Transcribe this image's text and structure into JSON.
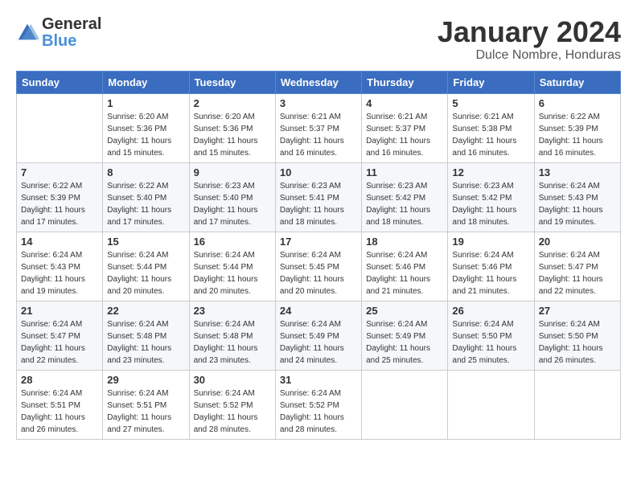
{
  "logo": {
    "text_general": "General",
    "text_blue": "Blue"
  },
  "title": "January 2024",
  "subtitle": "Dulce Nombre, Honduras",
  "weekdays": [
    "Sunday",
    "Monday",
    "Tuesday",
    "Wednesday",
    "Thursday",
    "Friday",
    "Saturday"
  ],
  "weeks": [
    [
      {
        "day": "",
        "sunrise": "",
        "sunset": "",
        "daylight": ""
      },
      {
        "day": "1",
        "sunrise": "Sunrise: 6:20 AM",
        "sunset": "Sunset: 5:36 PM",
        "daylight": "Daylight: 11 hours and 15 minutes."
      },
      {
        "day": "2",
        "sunrise": "Sunrise: 6:20 AM",
        "sunset": "Sunset: 5:36 PM",
        "daylight": "Daylight: 11 hours and 15 minutes."
      },
      {
        "day": "3",
        "sunrise": "Sunrise: 6:21 AM",
        "sunset": "Sunset: 5:37 PM",
        "daylight": "Daylight: 11 hours and 16 minutes."
      },
      {
        "day": "4",
        "sunrise": "Sunrise: 6:21 AM",
        "sunset": "Sunset: 5:37 PM",
        "daylight": "Daylight: 11 hours and 16 minutes."
      },
      {
        "day": "5",
        "sunrise": "Sunrise: 6:21 AM",
        "sunset": "Sunset: 5:38 PM",
        "daylight": "Daylight: 11 hours and 16 minutes."
      },
      {
        "day": "6",
        "sunrise": "Sunrise: 6:22 AM",
        "sunset": "Sunset: 5:39 PM",
        "daylight": "Daylight: 11 hours and 16 minutes."
      }
    ],
    [
      {
        "day": "7",
        "sunrise": "Sunrise: 6:22 AM",
        "sunset": "Sunset: 5:39 PM",
        "daylight": "Daylight: 11 hours and 17 minutes."
      },
      {
        "day": "8",
        "sunrise": "Sunrise: 6:22 AM",
        "sunset": "Sunset: 5:40 PM",
        "daylight": "Daylight: 11 hours and 17 minutes."
      },
      {
        "day": "9",
        "sunrise": "Sunrise: 6:23 AM",
        "sunset": "Sunset: 5:40 PM",
        "daylight": "Daylight: 11 hours and 17 minutes."
      },
      {
        "day": "10",
        "sunrise": "Sunrise: 6:23 AM",
        "sunset": "Sunset: 5:41 PM",
        "daylight": "Daylight: 11 hours and 18 minutes."
      },
      {
        "day": "11",
        "sunrise": "Sunrise: 6:23 AM",
        "sunset": "Sunset: 5:42 PM",
        "daylight": "Daylight: 11 hours and 18 minutes."
      },
      {
        "day": "12",
        "sunrise": "Sunrise: 6:23 AM",
        "sunset": "Sunset: 5:42 PM",
        "daylight": "Daylight: 11 hours and 18 minutes."
      },
      {
        "day": "13",
        "sunrise": "Sunrise: 6:24 AM",
        "sunset": "Sunset: 5:43 PM",
        "daylight": "Daylight: 11 hours and 19 minutes."
      }
    ],
    [
      {
        "day": "14",
        "sunrise": "Sunrise: 6:24 AM",
        "sunset": "Sunset: 5:43 PM",
        "daylight": "Daylight: 11 hours and 19 minutes."
      },
      {
        "day": "15",
        "sunrise": "Sunrise: 6:24 AM",
        "sunset": "Sunset: 5:44 PM",
        "daylight": "Daylight: 11 hours and 20 minutes."
      },
      {
        "day": "16",
        "sunrise": "Sunrise: 6:24 AM",
        "sunset": "Sunset: 5:44 PM",
        "daylight": "Daylight: 11 hours and 20 minutes."
      },
      {
        "day": "17",
        "sunrise": "Sunrise: 6:24 AM",
        "sunset": "Sunset: 5:45 PM",
        "daylight": "Daylight: 11 hours and 20 minutes."
      },
      {
        "day": "18",
        "sunrise": "Sunrise: 6:24 AM",
        "sunset": "Sunset: 5:46 PM",
        "daylight": "Daylight: 11 hours and 21 minutes."
      },
      {
        "day": "19",
        "sunrise": "Sunrise: 6:24 AM",
        "sunset": "Sunset: 5:46 PM",
        "daylight": "Daylight: 11 hours and 21 minutes."
      },
      {
        "day": "20",
        "sunrise": "Sunrise: 6:24 AM",
        "sunset": "Sunset: 5:47 PM",
        "daylight": "Daylight: 11 hours and 22 minutes."
      }
    ],
    [
      {
        "day": "21",
        "sunrise": "Sunrise: 6:24 AM",
        "sunset": "Sunset: 5:47 PM",
        "daylight": "Daylight: 11 hours and 22 minutes."
      },
      {
        "day": "22",
        "sunrise": "Sunrise: 6:24 AM",
        "sunset": "Sunset: 5:48 PM",
        "daylight": "Daylight: 11 hours and 23 minutes."
      },
      {
        "day": "23",
        "sunrise": "Sunrise: 6:24 AM",
        "sunset": "Sunset: 5:48 PM",
        "daylight": "Daylight: 11 hours and 23 minutes."
      },
      {
        "day": "24",
        "sunrise": "Sunrise: 6:24 AM",
        "sunset": "Sunset: 5:49 PM",
        "daylight": "Daylight: 11 hours and 24 minutes."
      },
      {
        "day": "25",
        "sunrise": "Sunrise: 6:24 AM",
        "sunset": "Sunset: 5:49 PM",
        "daylight": "Daylight: 11 hours and 25 minutes."
      },
      {
        "day": "26",
        "sunrise": "Sunrise: 6:24 AM",
        "sunset": "Sunset: 5:50 PM",
        "daylight": "Daylight: 11 hours and 25 minutes."
      },
      {
        "day": "27",
        "sunrise": "Sunrise: 6:24 AM",
        "sunset": "Sunset: 5:50 PM",
        "daylight": "Daylight: 11 hours and 26 minutes."
      }
    ],
    [
      {
        "day": "28",
        "sunrise": "Sunrise: 6:24 AM",
        "sunset": "Sunset: 5:51 PM",
        "daylight": "Daylight: 11 hours and 26 minutes."
      },
      {
        "day": "29",
        "sunrise": "Sunrise: 6:24 AM",
        "sunset": "Sunset: 5:51 PM",
        "daylight": "Daylight: 11 hours and 27 minutes."
      },
      {
        "day": "30",
        "sunrise": "Sunrise: 6:24 AM",
        "sunset": "Sunset: 5:52 PM",
        "daylight": "Daylight: 11 hours and 28 minutes."
      },
      {
        "day": "31",
        "sunrise": "Sunrise: 6:24 AM",
        "sunset": "Sunset: 5:52 PM",
        "daylight": "Daylight: 11 hours and 28 minutes."
      },
      {
        "day": "",
        "sunrise": "",
        "sunset": "",
        "daylight": ""
      },
      {
        "day": "",
        "sunrise": "",
        "sunset": "",
        "daylight": ""
      },
      {
        "day": "",
        "sunrise": "",
        "sunset": "",
        "daylight": ""
      }
    ]
  ]
}
